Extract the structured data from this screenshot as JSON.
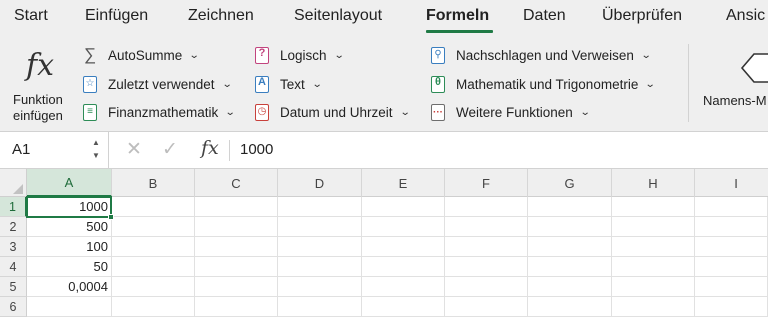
{
  "tabs": [
    {
      "label": "Start"
    },
    {
      "label": "Einfügen"
    },
    {
      "label": "Zeichnen"
    },
    {
      "label": "Seitenlayout"
    },
    {
      "label": "Formeln"
    },
    {
      "label": "Daten"
    },
    {
      "label": "Überprüfen"
    },
    {
      "label": "Ansic"
    }
  ],
  "active_tab": "Formeln",
  "ribbon": {
    "insert_function": {
      "line1": "Funktion",
      "line2": "einfügen",
      "icon": "fx-icon"
    },
    "col1": [
      {
        "label": "AutoSumme",
        "icon": "sigma-icon"
      },
      {
        "label": "Zuletzt verwendet",
        "icon": "star-icon"
      },
      {
        "label": "Finanzmathematik",
        "icon": "database-icon"
      }
    ],
    "col2": [
      {
        "label": "Logisch",
        "icon": "question-icon"
      },
      {
        "label": "Text",
        "icon": "text-a-icon"
      },
      {
        "label": "Datum und Uhrzeit",
        "icon": "clock-icon"
      }
    ],
    "col3": [
      {
        "label": "Nachschlagen und Verweisen",
        "icon": "magnifier-icon"
      },
      {
        "label": "Mathematik und Trigonometrie",
        "icon": "theta-icon"
      },
      {
        "label": "Weitere Funktionen",
        "icon": "more-dots-icon"
      }
    ],
    "names_manager": {
      "label": "Namens-M",
      "icon": "tag-icon"
    }
  },
  "formula_bar": {
    "name_box": "A1",
    "fx_symbol": "fx",
    "formula": "1000"
  },
  "grid": {
    "columns": [
      "A",
      "B",
      "C",
      "D",
      "E",
      "F",
      "G",
      "H",
      "I"
    ],
    "rows": [
      "1",
      "2",
      "3",
      "4",
      "5",
      "6"
    ],
    "column_a_values": [
      "1000",
      "500",
      "100",
      "50",
      "0,0004",
      ""
    ],
    "selected_cell": "A1"
  },
  "colors": {
    "accent": "#1f7a45",
    "ribbon_bg": "#efefef",
    "selection_bg": "#d5e6da"
  }
}
